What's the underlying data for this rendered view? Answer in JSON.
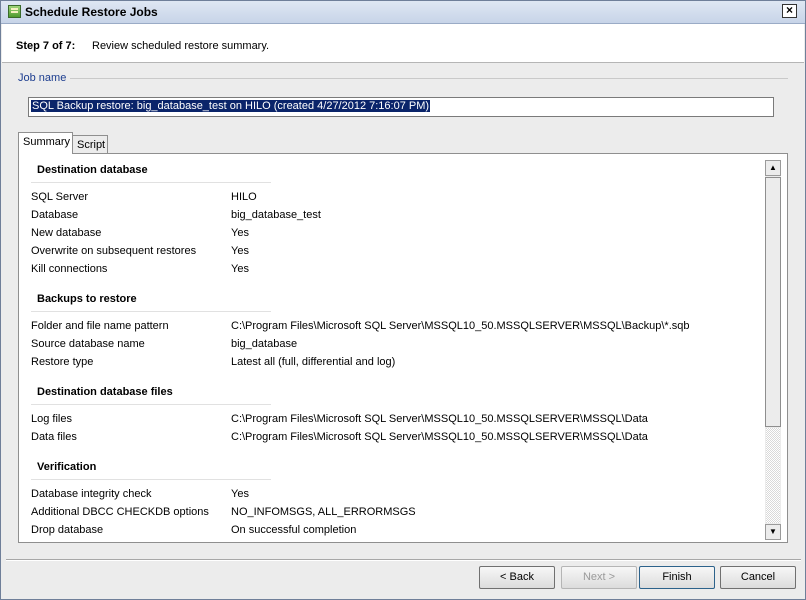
{
  "window": {
    "title": "Schedule Restore Jobs",
    "close_glyph": "×"
  },
  "header": {
    "step": "Step 7 of 7:",
    "description": "Review scheduled restore summary."
  },
  "job": {
    "label": "Job name",
    "value": "SQL Backup restore: big_database_test on HILO (created 4/27/2012 7:16:07 PM)"
  },
  "tabs": [
    {
      "label": "Summary"
    },
    {
      "label": "Script"
    }
  ],
  "summary": {
    "destination": {
      "heading": "Destination database",
      "rows": [
        {
          "label": "SQL Server",
          "value": "HILO"
        },
        {
          "label": "Database",
          "value": "big_database_test"
        },
        {
          "label": "New database",
          "value": "Yes"
        },
        {
          "label": "Overwrite on subsequent restores",
          "value": "Yes"
        },
        {
          "label": "Kill connections",
          "value": "Yes"
        }
      ]
    },
    "backups": {
      "heading": "Backups to restore",
      "rows": [
        {
          "label": "Folder and file name pattern",
          "value": "C:\\Program Files\\Microsoft SQL Server\\MSSQL10_50.MSSQLSERVER\\MSSQL\\Backup\\*.sqb"
        },
        {
          "label": "Source database name",
          "value": "big_database"
        },
        {
          "label": "Restore type",
          "value": "Latest all (full, differential and log)"
        }
      ]
    },
    "files": {
      "heading": "Destination database files",
      "rows": [
        {
          "label": "Log files",
          "value": "C:\\Program Files\\Microsoft SQL Server\\MSSQL10_50.MSSQLSERVER\\MSSQL\\Data"
        },
        {
          "label": "Data files",
          "value": "C:\\Program Files\\Microsoft SQL Server\\MSSQL10_50.MSSQLSERVER\\MSSQL\\Data"
        }
      ]
    },
    "verification": {
      "heading": "Verification",
      "rows": [
        {
          "label": "Database integrity check",
          "value": "Yes"
        },
        {
          "label": "Additional DBCC CHECKDB options",
          "value": "NO_INFOMSGS, ALL_ERRORMSGS"
        },
        {
          "label": "Drop database",
          "value": "On successful completion"
        }
      ]
    }
  },
  "buttons": {
    "back": "< Back",
    "next": "Next >",
    "finish": "Finish",
    "cancel": "Cancel"
  }
}
